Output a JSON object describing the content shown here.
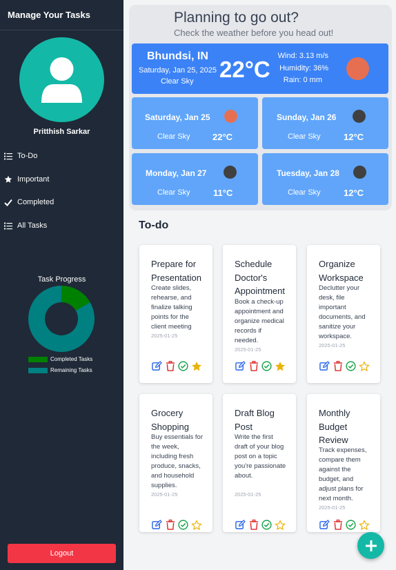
{
  "sidebar": {
    "title": "Manage Your Tasks",
    "user_name": "Pritthish Sarkar",
    "nav": [
      {
        "label": "To-Do",
        "icon": "list-icon"
      },
      {
        "label": "Important",
        "icon": "star-icon"
      },
      {
        "label": "Completed",
        "icon": "check-icon"
      },
      {
        "label": "All Tasks",
        "icon": "list-icon"
      }
    ],
    "progress_label": "Task Progress",
    "legend": [
      {
        "label": "Completed Tasks",
        "color": "#008000"
      },
      {
        "label": "Remaining Tasks",
        "color": "#008080"
      }
    ],
    "logout_label": "Logout"
  },
  "chart_data": {
    "type": "pie",
    "categories": [
      "Completed Tasks",
      "Remaining Tasks"
    ],
    "values": [
      1,
      5
    ],
    "colors": [
      "#008000",
      "#008080"
    ],
    "title": "Task Progress",
    "legend": "bottom"
  },
  "weather": {
    "heading": "Planning to go out?",
    "subheading": "Check the weather before you head out!",
    "today": {
      "city": "Bhundsi, IN",
      "date": "Saturday, Jan 25, 2025",
      "condition": "Clear Sky",
      "temp": "22°C",
      "wind": "Wind: 3.13 m/s",
      "humidity": "Humidity: 36%",
      "rain": "Rain: 0 mm",
      "icon": "sun-icon"
    },
    "forecast": [
      {
        "day": "Saturday, Jan 25",
        "condition": "Clear Sky",
        "temp": "22°C",
        "icon_color": "#e76f51"
      },
      {
        "day": "Sunday, Jan 26",
        "condition": "Clear Sky",
        "temp": "12°C",
        "icon_color": "#404040"
      },
      {
        "day": "Monday, Jan 27",
        "condition": "Clear Sky",
        "temp": "11°C",
        "icon_color": "#404040"
      },
      {
        "day": "Tuesday, Jan 28",
        "condition": "Clear Sky",
        "temp": "12°C",
        "icon_color": "#404040"
      }
    ]
  },
  "todo": {
    "heading": "To-do",
    "tasks": [
      {
        "title": "Prepare for Presentation",
        "description": "Create slides, rehearse, and finalize talking points for the client meeting",
        "date": "2025-01-25",
        "important": true
      },
      {
        "title": "Schedule Doctor's Appointment",
        "description": "Book a check-up appointment and organize medical records if needed.",
        "date": "2025-01-25",
        "important": true
      },
      {
        "title": "Organize Workspace",
        "description": "Declutter your desk, file important documents, and sanitize your workspace.",
        "date": "2025-01-25",
        "important": false
      },
      {
        "title": "Grocery Shopping",
        "description": "Buy essentials for the week, including fresh produce, snacks, and household supplies.",
        "date": "2025-01-25",
        "important": false
      },
      {
        "title": "Draft Blog Post",
        "description": "Write the first draft of your blog post on a topic you're passionate about.",
        "date": "2025-01-25",
        "important": false
      },
      {
        "title": "Monthly Budget Review",
        "description": "Track expenses, compare them against the budget, and adjust plans for next month.",
        "date": "2025-01-25",
        "important": false
      }
    ]
  },
  "colors": {
    "sidebar": "#1f2937",
    "accent": "#14b8a6",
    "today_card": "#3b82f6",
    "forecast_card": "#60a5fa",
    "logout": "#f23645"
  }
}
